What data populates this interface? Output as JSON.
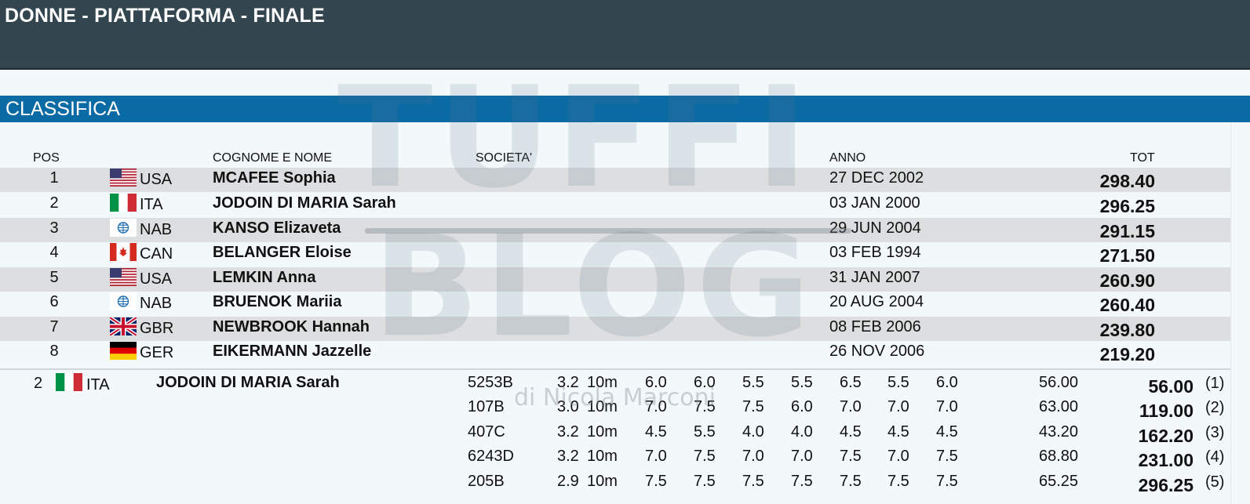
{
  "header": {
    "title": "DONNE - PIATTAFORMA - FINALE"
  },
  "section": {
    "label": "CLASSIFICA"
  },
  "watermark": {
    "line1": "TUFFI",
    "line2": "BLOG",
    "line3": "di Nicola Marconi"
  },
  "columns": {
    "pos": "POS",
    "name": "COGNOME E NOME",
    "club": "SOCIETA'",
    "year": "ANNO",
    "tot": "TOT"
  },
  "ranking": [
    {
      "pos": "1",
      "flag": "usa-flag-icon",
      "nat": "USA",
      "name": "MCAFEE Sophia",
      "date": "27 DEC 2002",
      "tot": "298.40"
    },
    {
      "pos": "2",
      "flag": "ita-flag-icon",
      "nat": "ITA",
      "name": "JODOIN DI MARIA Sarah",
      "date": "03 JAN 2000",
      "tot": "296.25"
    },
    {
      "pos": "3",
      "flag": "nab-flag-icon",
      "nat": "NAB",
      "name": "KANSO Elizaveta",
      "date": "29 JUN 2004",
      "tot": "291.15"
    },
    {
      "pos": "4",
      "flag": "can-flag-icon",
      "nat": "CAN",
      "name": "BELANGER Eloise",
      "date": "03 FEB 1994",
      "tot": "271.50"
    },
    {
      "pos": "5",
      "flag": "usa-flag-icon",
      "nat": "USA",
      "name": "LEMKIN Anna",
      "date": "31 JAN 2007",
      "tot": "260.90"
    },
    {
      "pos": "6",
      "flag": "nab-flag-icon",
      "nat": "NAB",
      "name": "BRUENOK Mariia",
      "date": "20 AUG 2004",
      "tot": "260.40"
    },
    {
      "pos": "7",
      "flag": "gbr-flag-icon",
      "nat": "GBR",
      "name": "NEWBROOK Hannah",
      "date": "08 FEB 2006",
      "tot": "239.80"
    },
    {
      "pos": "8",
      "flag": "ger-flag-icon",
      "nat": "GER",
      "name": "EIKERMANN Jazzelle",
      "date": "26 NOV 2006",
      "tot": "219.20"
    }
  ],
  "detail": {
    "pos": "2",
    "flag": "ita-flag-icon",
    "nat": "ITA",
    "name": "JODOIN DI MARIA Sarah",
    "dives": [
      {
        "code": "5253B",
        "dd": "3.2",
        "height": "10m",
        "scores": [
          "6.0",
          "6.0",
          "5.5",
          "5.5",
          "6.5",
          "5.5",
          "6.0"
        ],
        "points": "56.00",
        "cumulative": "56.00",
        "round": "(1)"
      },
      {
        "code": "107B",
        "dd": "3.0",
        "height": "10m",
        "scores": [
          "7.0",
          "7.5",
          "7.5",
          "6.0",
          "7.0",
          "7.0",
          "7.0"
        ],
        "points": "63.00",
        "cumulative": "119.00",
        "round": "(2)"
      },
      {
        "code": "407C",
        "dd": "3.2",
        "height": "10m",
        "scores": [
          "4.5",
          "5.5",
          "4.0",
          "4.0",
          "4.5",
          "4.5",
          "4.5"
        ],
        "points": "43.20",
        "cumulative": "162.20",
        "round": "(3)"
      },
      {
        "code": "6243D",
        "dd": "3.2",
        "height": "10m",
        "scores": [
          "7.0",
          "7.5",
          "7.0",
          "7.0",
          "7.5",
          "7.0",
          "7.5"
        ],
        "points": "68.80",
        "cumulative": "231.00",
        "round": "(4)"
      },
      {
        "code": "205B",
        "dd": "2.9",
        "height": "10m",
        "scores": [
          "7.5",
          "7.5",
          "7.5",
          "7.5",
          "7.5",
          "7.5",
          "7.5"
        ],
        "points": "65.25",
        "cumulative": "296.25",
        "round": "(5)"
      }
    ]
  }
}
